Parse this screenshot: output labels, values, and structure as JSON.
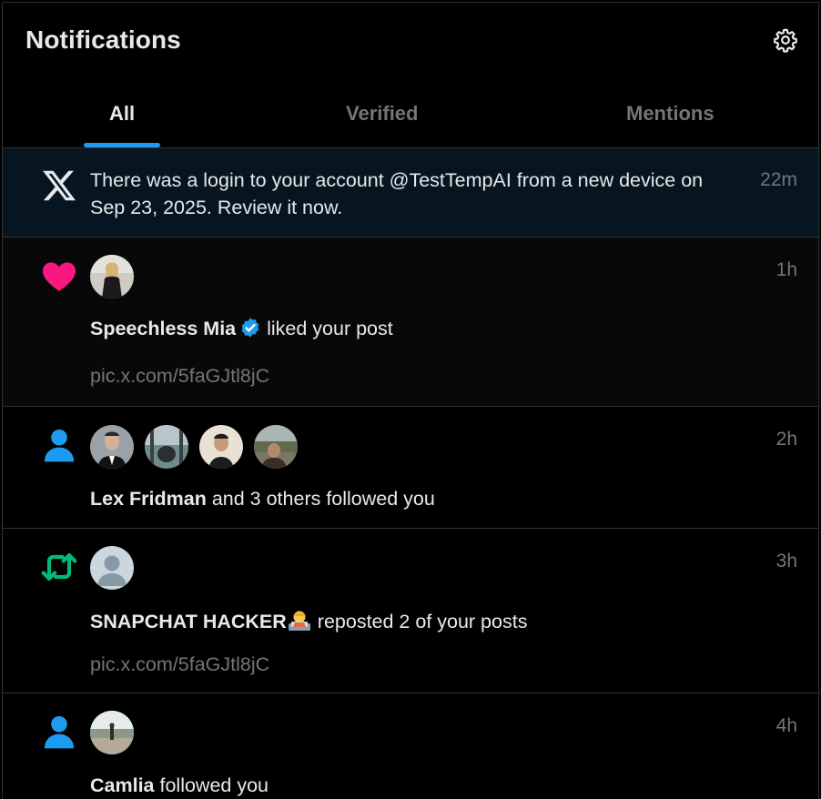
{
  "header": {
    "title": "Notifications",
    "settings_icon": "gear-icon"
  },
  "tabs": [
    {
      "label": "All",
      "active": true
    },
    {
      "label": "Verified",
      "active": false
    },
    {
      "label": "Mentions",
      "active": false
    }
  ],
  "colors": {
    "accent": "#1d9bf0",
    "like": "#f91880",
    "repost": "#00ba7c",
    "muted": "#71767b",
    "highlight_bg": "#061520"
  },
  "notifications": [
    {
      "type": "login-alert",
      "icon": "x-logo-icon",
      "text": "There was a login to your account @TestTempAI from a new device on Sep 23, 2025. Review it now.",
      "time": "22m"
    },
    {
      "type": "like",
      "icon": "heart-icon",
      "user": "Speechless Mia",
      "verified": true,
      "action": " liked your post",
      "link": "pic.x.com/5faGJtl8jC",
      "time": "1h"
    },
    {
      "type": "follow",
      "icon": "person-icon",
      "user": "Lex Fridman",
      "action": " and 3 others followed you",
      "avatar_count": 4,
      "time": "2h"
    },
    {
      "type": "repost",
      "icon": "repost-icon",
      "user": "SNAPCHAT HACKER",
      "user_emoji": "technologist-emoji",
      "action": " reposted 2 of your posts",
      "link": "pic.x.com/5faGJtl8jC",
      "time": "3h"
    },
    {
      "type": "follow",
      "icon": "person-icon",
      "user": "Camlia",
      "action": " followed you",
      "time": "4h"
    }
  ]
}
